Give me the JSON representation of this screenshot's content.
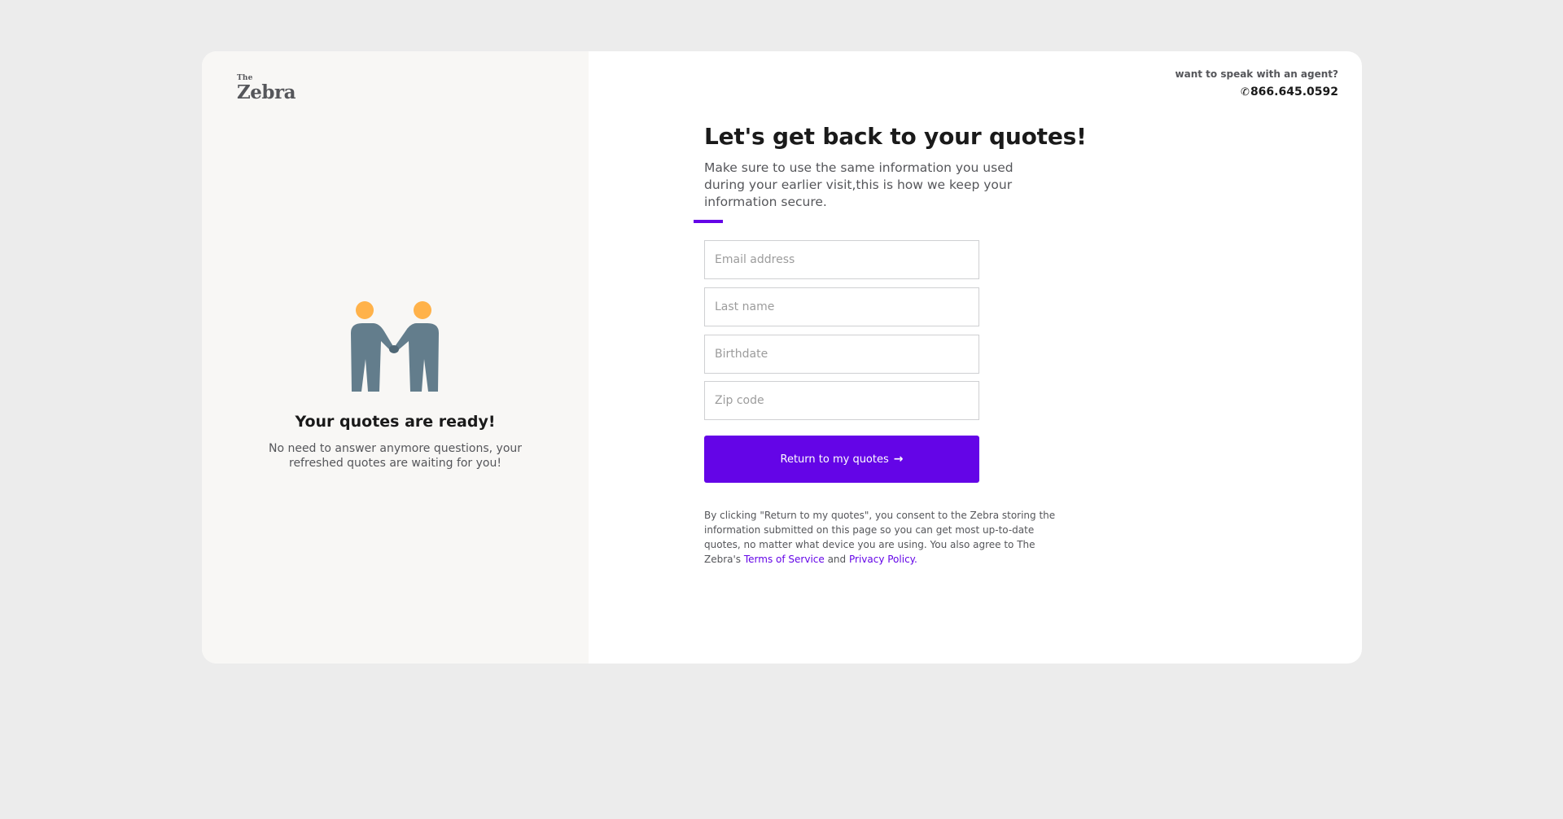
{
  "brand": {
    "logo_top": "The",
    "logo_main": "Zebra",
    "accent_color": "#6405e7"
  },
  "left_panel": {
    "illustration": "handshake-people-icon",
    "title": "Your quotes are ready!",
    "subtitle": "No need to answer anymore questions, your refreshed quotes are waiting for you!"
  },
  "agent": {
    "prompt": "want to speak with an agent?",
    "phone_icon": "phone-icon",
    "phone": "866.645.0592"
  },
  "main": {
    "title": "Let's get back to your quotes!",
    "subtitle": "Make sure to use the same information you used during your earlier visit,this is how we keep your information secure."
  },
  "form": {
    "email_placeholder": "Email address",
    "email_value": "",
    "lastname_placeholder": "Last name",
    "lastname_value": "",
    "birthdate_placeholder": "Birthdate",
    "birthdate_value": "",
    "zip_placeholder": "Zip code",
    "zip_value": "",
    "submit_label": "Return to my quotes",
    "submit_icon": "arrow-right-icon"
  },
  "legal": {
    "text_before": "By clicking \"Return to my quotes\", you consent to the Zebra storing the information submitted on this page so you can get most up-to-date quotes, no matter what device you are using. You also agree to The Zebra's ",
    "terms_link": "Terms of Service",
    "text_between": " and ",
    "privacy_link": "Privacy Policy."
  }
}
